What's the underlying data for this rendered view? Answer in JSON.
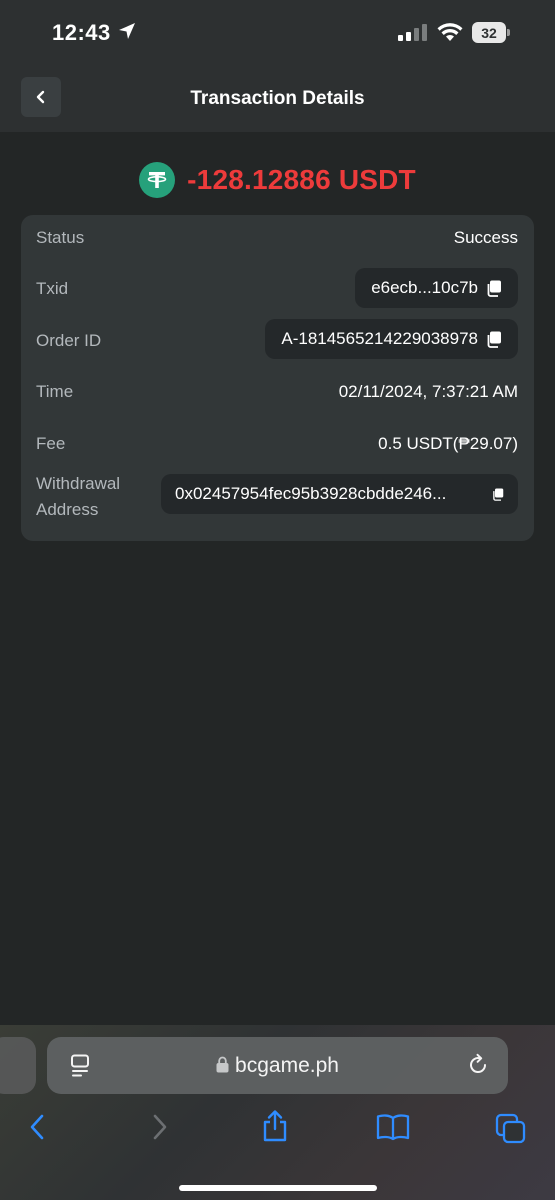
{
  "status_bar": {
    "time": "12:43",
    "battery": "32"
  },
  "header": {
    "title": "Transaction Details"
  },
  "transaction": {
    "currency_icon": "tether-icon",
    "amount": "-128.12886 USDT",
    "amount_color": "#ed3b3b",
    "rows": {
      "status": {
        "label": "Status",
        "value": "Success"
      },
      "txid": {
        "label": "Txid",
        "value": "e6ecb...10c7b"
      },
      "order_id": {
        "label": "Order ID",
        "value": "A-1814565214229038978"
      },
      "time": {
        "label": "Time",
        "value": "02/11/2024, 7:37:21 AM"
      },
      "fee": {
        "label": "Fee",
        "value": "0.5 USDT(₱29.07)"
      },
      "withdrawal_address": {
        "label_line1": "Withdrawal",
        "label_line2": "Address",
        "value": "0x02457954fec95b3928cbdde246..."
      }
    }
  },
  "browser": {
    "url": "bcgame.ph"
  },
  "colors": {
    "background": "#232626",
    "card": "#323738",
    "accent_green": "#26a17b",
    "link_blue": "#2f8cff"
  }
}
